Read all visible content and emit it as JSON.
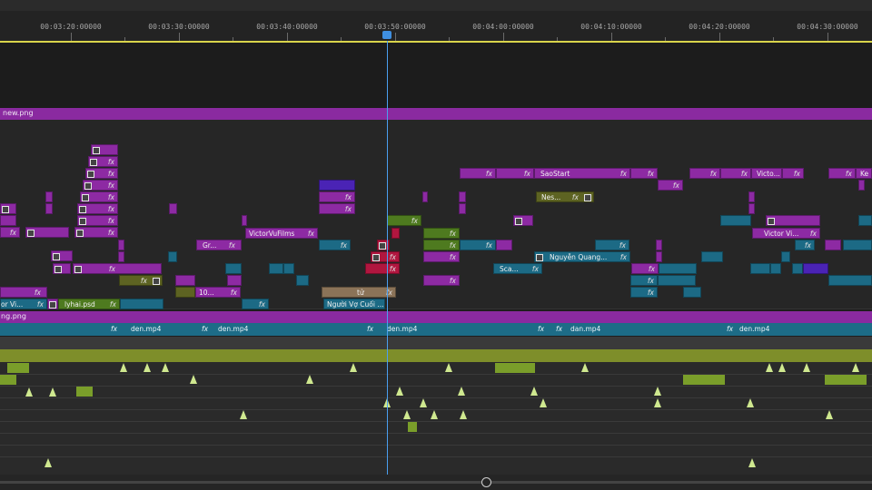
{
  "ruler": {
    "timecodes": [
      "00:03:20:00000",
      "00:03:30:00000",
      "00:03:40:00000",
      "00:03:50:00000",
      "00:04:00:00000",
      "00:04:10:00000",
      "00:04:20:00000",
      "00:04:30:00000"
    ]
  },
  "tracks": {
    "v1_label": "new.png",
    "a1_label": "ng.png"
  },
  "clips": {
    "saostart": "SaoStart",
    "victo_top": "Victo...",
    "ke": "Ke",
    "nes": "Nes...",
    "victorvufilms": "VictorVuFilms",
    "victor_vi_right": "Victor Vi...",
    "gr": "Gr...",
    "nguyen": "Nguyễn Quang...",
    "sca": "Sca...",
    "ten": "10...",
    "tu": "tử",
    "nguoi": "Người Vợ Cuối ...",
    "or_vi": "or Vi...",
    "lyhai": "lyhai.psd"
  },
  "audio": {
    "clip_label": "den.mp4",
    "clip_label_alt": "dan.mp4"
  },
  "colors": {
    "purple": "#8d2aa3",
    "teal": "#1c6a85",
    "green": "#4e7a1f",
    "red": "#b1163f",
    "playhead": "#4a9ff0",
    "ruler_line": "#d8d44a"
  },
  "icons": [
    "playhead-icon",
    "fx-badge-icon",
    "image-thumb-icon",
    "zoom-knob-icon"
  ]
}
